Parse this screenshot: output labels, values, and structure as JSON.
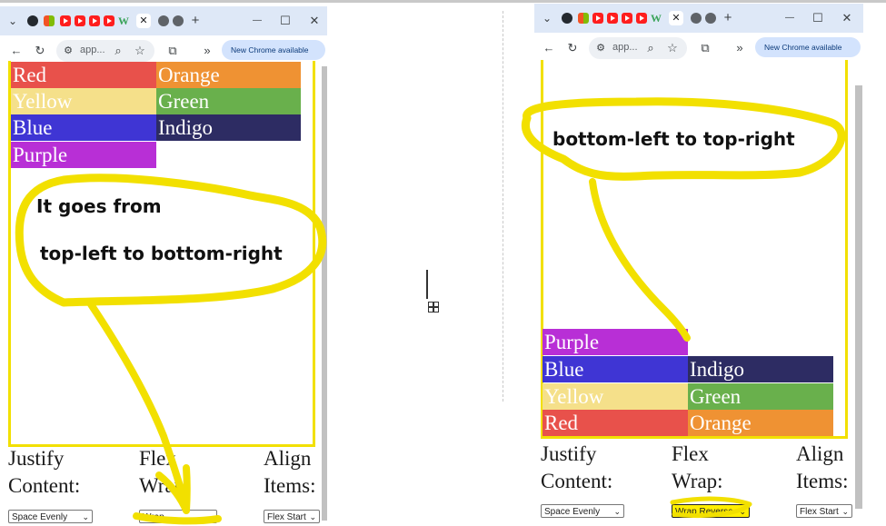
{
  "browser": {
    "address_text": "app...",
    "chrome_available": "New Chrome available",
    "new_tab_symbol": "+",
    "tab_close_symbol": "✕",
    "minimize_symbol": "—",
    "maximize_symbol": "☐",
    "close_symbol": "✕",
    "extensions_symbol": "»"
  },
  "left_panel": {
    "swatches": [
      "Red",
      "Orange",
      "Yellow",
      "Green",
      "Blue",
      "Indigo",
      "Purple"
    ],
    "controls": {
      "justify_label_line1": "Justify",
      "justify_label_line2": "Content:",
      "wrap_label_line1": "Flex",
      "wrap_label_line2": "Wrap:",
      "align_label_line1": "Align",
      "align_label_line2": "Items:",
      "justify_value": "Space Evenly",
      "wrap_value": "Wrap",
      "align_value": "Flex Start"
    },
    "annotation_line1": "It goes from",
    "annotation_line2": "top-left to bottom-right"
  },
  "right_panel": {
    "swatches": [
      "Purple",
      "Blue",
      "Indigo",
      "Yellow",
      "Green",
      "Red",
      "Orange"
    ],
    "controls": {
      "justify_label_line1": "Justify",
      "justify_label_line2": "Content:",
      "wrap_label_line1": "Flex",
      "wrap_label_line2": "Wrap:",
      "align_label_line1": "Align",
      "align_label_line2": "Items:",
      "justify_value": "Space Evenly",
      "wrap_value": "Wrap Reverse",
      "align_value": "Flex Start"
    },
    "annotation": "bottom-left to top-right"
  },
  "colors": {
    "highlighter": "#f2e000",
    "red": "#e8514b",
    "orange": "#ef9233",
    "yellow": "#f5e08a",
    "green": "#69b04c",
    "blue": "#3f35d4",
    "indigo": "#2d2c63",
    "purple": "#b82fd6"
  },
  "icons": [
    "chevron-down-icon",
    "github-icon",
    "microsoft-icon",
    "youtube-icon",
    "w-icon",
    "close-icon",
    "globe-icon",
    "new-tab-icon",
    "back-icon",
    "reload-icon",
    "site-info-icon",
    "zoom-icon",
    "star-icon",
    "extensions-icon",
    "more-icon",
    "kebab-icon",
    "move-cursor-icon"
  ]
}
